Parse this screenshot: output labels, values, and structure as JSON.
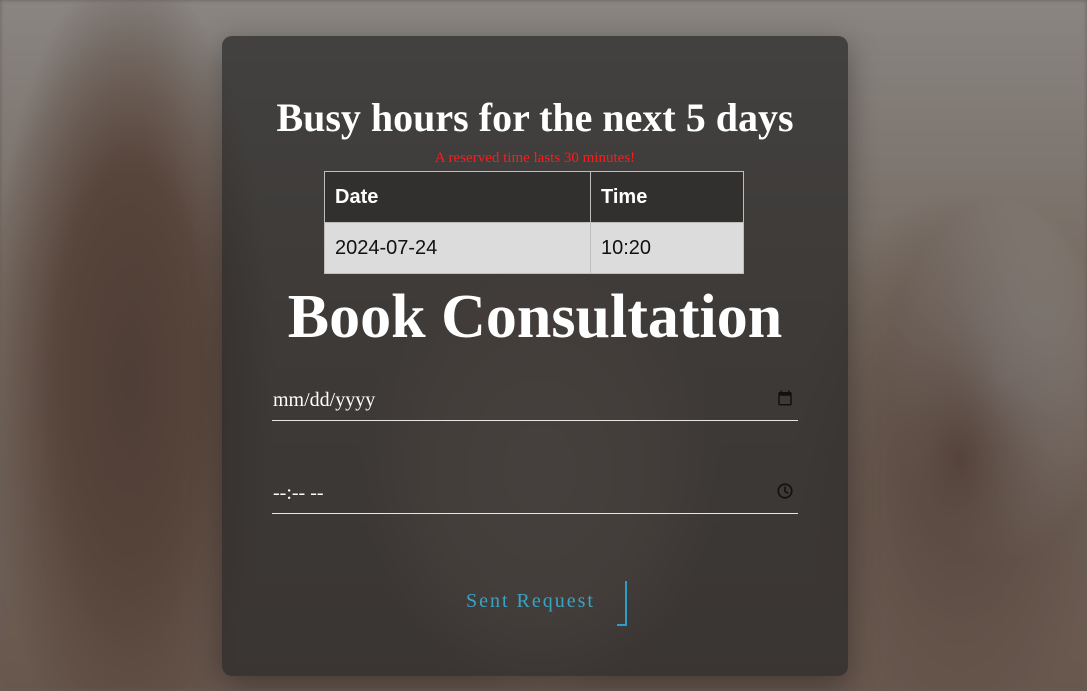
{
  "busy": {
    "title": "Busy hours for the next 5 days",
    "note": "A reserved time lasts 30 minutes!",
    "columns": [
      "Date",
      "Time"
    ],
    "rows": [
      {
        "date": "2024-07-24",
        "time": "10:20"
      }
    ]
  },
  "booking": {
    "title": "Book Consultation",
    "date_placeholder": "mm/dd/yyyy",
    "time_placeholder": "--:-- --",
    "submit_label": "Sent Request"
  },
  "icons": {
    "date": "calendar-icon",
    "time": "clock-icon"
  },
  "colors": {
    "note": "#ff1a1a",
    "submit": "#3aa3c4"
  }
}
